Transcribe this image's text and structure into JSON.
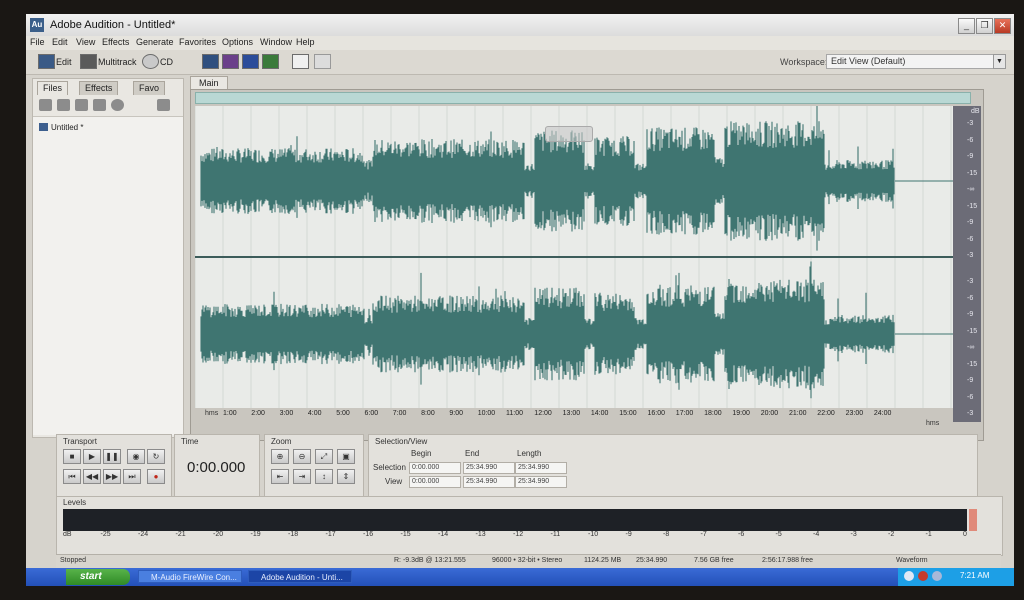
{
  "window": {
    "title": "Adobe Audition - Untitled*",
    "app_icon": "Au"
  },
  "menu": [
    "File",
    "Edit",
    "View",
    "Effects",
    "Generate",
    "Favorites",
    "Options",
    "Window",
    "Help"
  ],
  "toolbar": {
    "edit_label": "Edit",
    "multitrack_label": "Multitrack",
    "cd_label": "CD",
    "workspace_label": "Workspace:",
    "workspace_value": "Edit View (Default)"
  },
  "left_panel": {
    "tabs": [
      "Files",
      "Effects",
      "Favo"
    ],
    "files": [
      "Untitled *"
    ]
  },
  "main": {
    "tab": "Main",
    "ruler_unit": "hms",
    "db_unit": "dB",
    "time_ticks": [
      "1:00",
      "2:00",
      "3:00",
      "4:00",
      "5:00",
      "6:00",
      "7:00",
      "8:00",
      "9:00",
      "10:00",
      "11:00",
      "12:00",
      "13:00",
      "14:00",
      "15:00",
      "16:00",
      "17:00",
      "18:00",
      "19:00",
      "20:00",
      "21:00",
      "22:00",
      "23:00",
      "24:00"
    ],
    "db_ticks_channel": [
      "-3",
      "-6",
      "-9",
      "-15",
      "-∞",
      "-15",
      "-9",
      "-6",
      "-3"
    ]
  },
  "transport": {
    "title": "Transport"
  },
  "time": {
    "title": "Time",
    "value": "0:00.000"
  },
  "zoom": {
    "title": "Zoom"
  },
  "selection": {
    "title": "Selection/View",
    "headers": [
      "Begin",
      "End",
      "Length"
    ],
    "rows": [
      {
        "label": "Selection",
        "begin": "0:00.000",
        "end": "25:34.990",
        "length": "25:34.990"
      },
      {
        "label": "View",
        "begin": "0:00.000",
        "end": "25:34.990",
        "length": "25:34.990"
      }
    ]
  },
  "levels": {
    "title": "Levels",
    "scale": [
      "dB",
      "-25",
      "-24",
      "-21",
      "-20",
      "-19",
      "-18",
      "-17",
      "-16",
      "-15",
      "-14",
      "-13",
      "-12",
      "-11",
      "-10",
      "-9",
      "-8",
      "-7",
      "-6",
      "-5",
      "-4",
      "-3",
      "-2",
      "-1",
      "0"
    ]
  },
  "status": {
    "state": "Stopped",
    "level": "R: -9.3dB @ 13:21.555",
    "format": "96000 • 32-bit • Stereo",
    "size": "1124.25 MB",
    "duration": "25:34.990",
    "disk_free": "7.56 GB free",
    "time_free": "2:56:17.988 free",
    "view": "Waveform"
  },
  "taskbar": {
    "start": "start",
    "tasks": [
      "M-Audio FireWire Con...",
      "Adobe Audition - Unti..."
    ],
    "clock": "7:21 AM"
  }
}
